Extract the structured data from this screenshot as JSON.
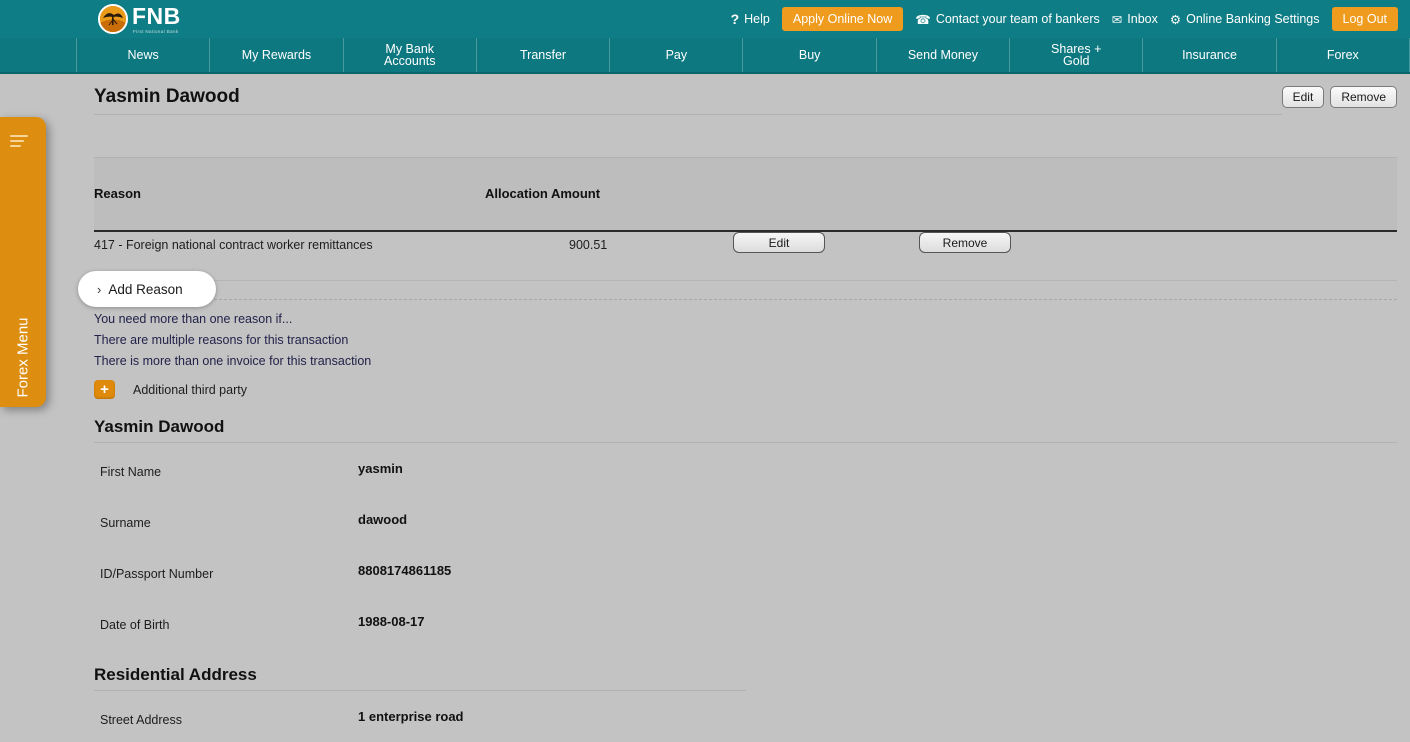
{
  "header": {
    "logo": {
      "brand": "FNB",
      "tagline": "First National Bank",
      "icon": "acacia-tree-logo"
    },
    "links": [
      {
        "id": "help",
        "icon": "question-icon",
        "icon_glyph": "?",
        "label": "Help",
        "type": "link"
      },
      {
        "id": "apply-online-now",
        "label": "Apply Online Now",
        "type": "button"
      },
      {
        "id": "contact-bankers",
        "icon": "phone-icon",
        "icon_glyph": "☎",
        "label": "Contact your team of bankers",
        "type": "link"
      },
      {
        "id": "inbox",
        "icon": "envelope-icon",
        "icon_glyph": "✉",
        "label": "Inbox",
        "type": "link"
      },
      {
        "id": "online-banking-settings",
        "icon": "gear-icon",
        "icon_glyph": "⚙",
        "label": "Online Banking Settings",
        "type": "link"
      },
      {
        "id": "log-out",
        "label": "Log Out",
        "type": "button"
      }
    ],
    "accent_orange": "#ef9b1d",
    "teal": "#0f7d85"
  },
  "nav": {
    "items": [
      {
        "id": "news",
        "line1": "News",
        "line2": ""
      },
      {
        "id": "my-rewards",
        "line1": "My Rewards",
        "line2": ""
      },
      {
        "id": "my-bank-accounts",
        "line1": "My Bank",
        "line2": "Accounts"
      },
      {
        "id": "transfer",
        "line1": "Transfer",
        "line2": ""
      },
      {
        "id": "pay",
        "line1": "Pay",
        "line2": ""
      },
      {
        "id": "buy",
        "line1": "Buy",
        "line2": ""
      },
      {
        "id": "send-money",
        "line1": "Send Money",
        "line2": ""
      },
      {
        "id": "shares-gold",
        "line1": "Shares +",
        "line2": "Gold"
      },
      {
        "id": "insurance",
        "line1": "Insurance",
        "line2": ""
      },
      {
        "id": "forex",
        "line1": "Forex",
        "line2": ""
      }
    ]
  },
  "sidebar": {
    "label": "Forex Menu",
    "icon": "hamburger-icon",
    "color": "#dd8e10"
  },
  "page": {
    "title": "Yasmin Dawood",
    "edit_label": "Edit",
    "remove_label": "Remove"
  },
  "reasons_table": {
    "columns": [
      "Reason",
      "Allocation Amount"
    ],
    "rows": [
      {
        "reason": "417 - Foreign national contract worker remittances",
        "amount": "900.51",
        "edit_label": "Edit",
        "remove_label": "Remove"
      }
    ],
    "add_reason": {
      "label": "Add Reason",
      "chevron": "›"
    }
  },
  "notes": {
    "heading": "You need more than one reason if...",
    "lines": [
      "There are multiple reasons for this transaction",
      "There is more than one invoice for this transaction"
    ],
    "third_party": {
      "icon": "plus-icon",
      "glyph": "+",
      "label": "Additional third party"
    }
  },
  "person": {
    "section_title": "Yasmin Dawood",
    "fields": [
      {
        "label": "First Name",
        "value": "yasmin"
      },
      {
        "label": "Surname",
        "value": "dawood"
      },
      {
        "label": "ID/Passport Number",
        "value": "8808174861185"
      },
      {
        "label": "Date of Birth",
        "value": "1988-08-17"
      }
    ]
  },
  "address": {
    "section_title": "Residential Address",
    "fields": [
      {
        "label": "Street Address",
        "value": "1 enterprise road"
      }
    ]
  }
}
